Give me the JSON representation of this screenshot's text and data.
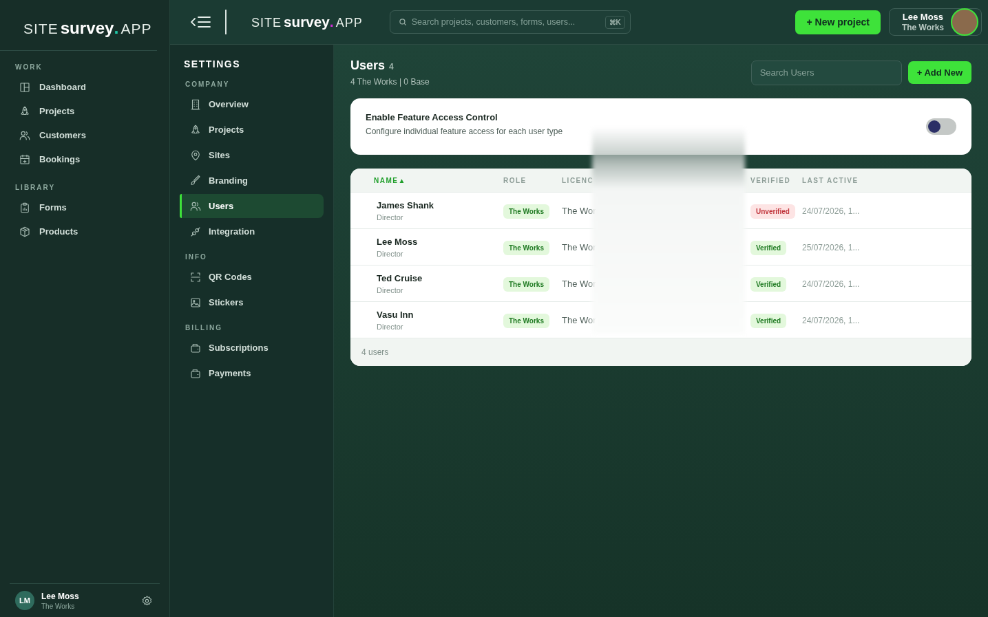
{
  "sidebar": {
    "logo": {
      "prefix": "SITE",
      "brand": "survey",
      "dot": ".",
      "suffix": "APP"
    },
    "sections": [
      {
        "title": "WORK",
        "items": [
          {
            "label": "Dashboard",
            "selected": false
          },
          {
            "label": "Projects",
            "selected": false
          },
          {
            "label": "Customers",
            "selected": false
          },
          {
            "label": "Bookings",
            "selected": false
          }
        ]
      },
      {
        "title": "LIBRARY",
        "items": [
          {
            "label": "Forms",
            "selected": false
          },
          {
            "label": "Products",
            "selected": false
          }
        ]
      }
    ],
    "user": {
      "initials": "LM",
      "name": "Lee Moss",
      "company": "The Works"
    }
  },
  "topbar": {
    "logo": {
      "prefix": "SITE",
      "brand": "survey",
      "dot": ".",
      "suffix": "APP"
    },
    "search": {
      "placeholder": "Search projects, customers, forms, users...",
      "shortcut": "⌘K"
    },
    "new_project": "+ New project",
    "user": {
      "name": "Lee Moss",
      "company": "The Works"
    }
  },
  "settings": {
    "title": "SETTINGS",
    "sections": [
      {
        "title": "COMPANY",
        "items": [
          {
            "label": "Overview",
            "selected": false
          },
          {
            "label": "Projects",
            "selected": false
          },
          {
            "label": "Sites",
            "selected": false
          },
          {
            "label": "Branding",
            "selected": false
          },
          {
            "label": "Users",
            "selected": true
          },
          {
            "label": "Integration",
            "selected": false
          }
        ]
      },
      {
        "title": "INFO",
        "items": [
          {
            "label": "QR Codes",
            "selected": false
          },
          {
            "label": "Stickers",
            "selected": false
          }
        ]
      },
      {
        "title": "BILLING",
        "items": [
          {
            "label": "Subscriptions",
            "selected": false
          },
          {
            "label": "Payments",
            "selected": false
          }
        ]
      }
    ]
  },
  "users": {
    "title": "Users",
    "count": "4",
    "subtitle": "4 The Works | 0 Base",
    "search": {
      "placeholder": "Search Users"
    },
    "add_button": "+ Add New",
    "feature_access": {
      "title": "Enable Feature Access Control",
      "description": "Configure individual feature access for each user type",
      "on": false
    },
    "table": {
      "columns": [
        {
          "label": "NAME",
          "sort_indicator": "▲",
          "selected": true
        },
        {
          "label": "ROLE",
          "selected": false
        },
        {
          "label": "LICENC",
          "selected": false
        },
        {
          "label": "VERIFIED",
          "selected": false
        },
        {
          "label": "LAST ACTIVE",
          "selected": false
        }
      ],
      "rows": [
        {
          "name": "James Shank",
          "title": "Director",
          "role": "The Works",
          "licence": "The Wor",
          "verified": false,
          "status": "Unverified",
          "last_active": "24/07/2026, 1..."
        },
        {
          "name": "Lee Moss",
          "title": "Director",
          "role": "The Works",
          "licence": "The Wor",
          "verified": true,
          "status": "Verified",
          "last_active": "25/07/2026, 1..."
        },
        {
          "name": "Ted Cruise",
          "title": "Director",
          "role": "The Works",
          "licence": "The Wor",
          "verified": true,
          "status": "Verified",
          "last_active": "24/07/2026, 1..."
        },
        {
          "name": "Vasu Inn",
          "title": "Director",
          "role": "The Works",
          "licence": "The Wor",
          "verified": true,
          "status": "Verified",
          "last_active": "24/07/2026, 1..."
        }
      ],
      "footer": "4 users"
    }
  }
}
